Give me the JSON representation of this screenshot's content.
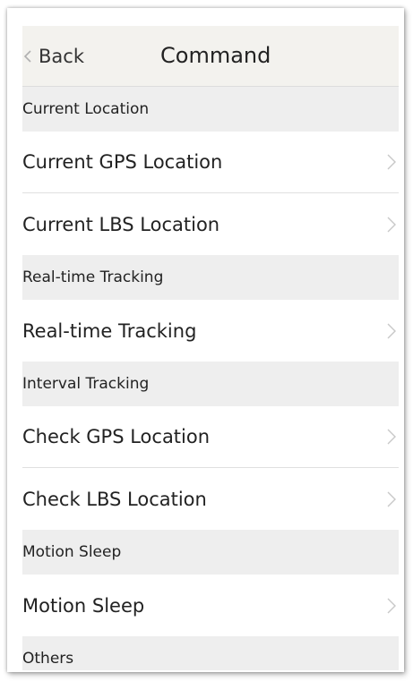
{
  "nav": {
    "back_label": "Back",
    "title": "Command"
  },
  "sections": [
    {
      "header": "Current Location",
      "items": [
        "Current GPS Location",
        "Current LBS Location"
      ]
    },
    {
      "header": "Real-time Tracking",
      "items": [
        "Real-time Tracking"
      ]
    },
    {
      "header": "Interval Tracking",
      "items": [
        "Check GPS Location",
        "Check LBS Location"
      ]
    },
    {
      "header": "Motion Sleep",
      "items": [
        "Motion Sleep"
      ]
    },
    {
      "header": "Others",
      "items": []
    }
  ],
  "colors": {
    "nav_background": "#f3f2ee",
    "section_background": "#eeeeee",
    "chevron": "#c8c8c8"
  },
  "icons": {
    "back": "chevron-left-icon",
    "row": "chevron-right-icon"
  }
}
